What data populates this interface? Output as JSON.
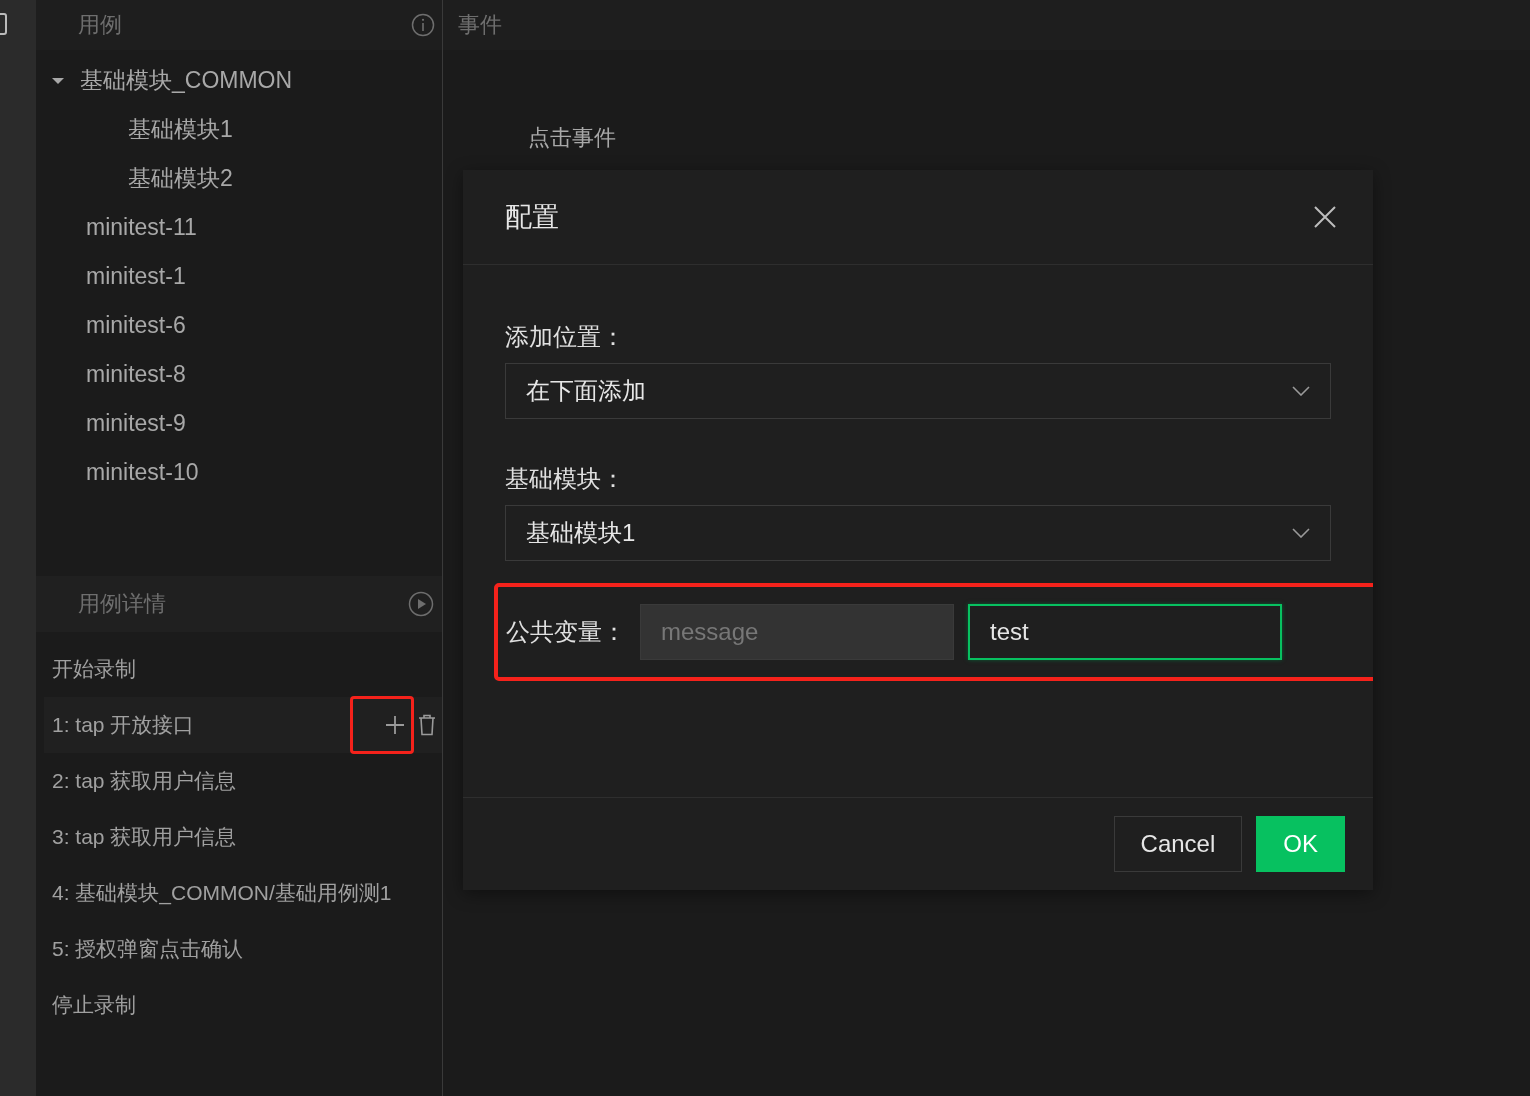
{
  "cases_panel": {
    "title": "用例",
    "tree": [
      {
        "label": "基础模块_COMMON",
        "expanded": true,
        "children": [
          {
            "label": "基础模块1"
          },
          {
            "label": "基础模块2"
          }
        ]
      },
      {
        "label": "minitest-11"
      },
      {
        "label": "minitest-1"
      },
      {
        "label": "minitest-6"
      },
      {
        "label": "minitest-8"
      },
      {
        "label": "minitest-9"
      },
      {
        "label": "minitest-10"
      }
    ]
  },
  "details_panel": {
    "title": "用例详情",
    "steps": [
      {
        "label": "开始录制",
        "selected": false
      },
      {
        "label": "1: tap 开放接口",
        "selected": true,
        "add_highlighted": true
      },
      {
        "label": "2: tap 获取用户信息",
        "selected": false
      },
      {
        "label": "3: tap 获取用户信息",
        "selected": false
      },
      {
        "label": "4: 基础模块_COMMON/基础用例测1",
        "selected": false
      },
      {
        "label": "5: 授权弹窗点击确认",
        "selected": false
      },
      {
        "label": "停止录制",
        "selected": false
      }
    ]
  },
  "events_panel": {
    "title": "事件",
    "items": [
      "点击事件"
    ]
  },
  "dialog": {
    "title": "配置",
    "fields": [
      {
        "kind": "select",
        "label": "添加位置：",
        "value": "在下面添加"
      },
      {
        "kind": "select",
        "label": "基础模块：",
        "value": "基础模块1"
      },
      {
        "kind": "pair",
        "label": "公共变量：",
        "key": {
          "value": "message",
          "disabled": true
        },
        "value": {
          "value": "test",
          "focused": true
        },
        "highlighted": true
      }
    ],
    "buttons": [
      {
        "label": "Cancel",
        "kind": "default"
      },
      {
        "label": "OK",
        "kind": "primary"
      }
    ]
  }
}
